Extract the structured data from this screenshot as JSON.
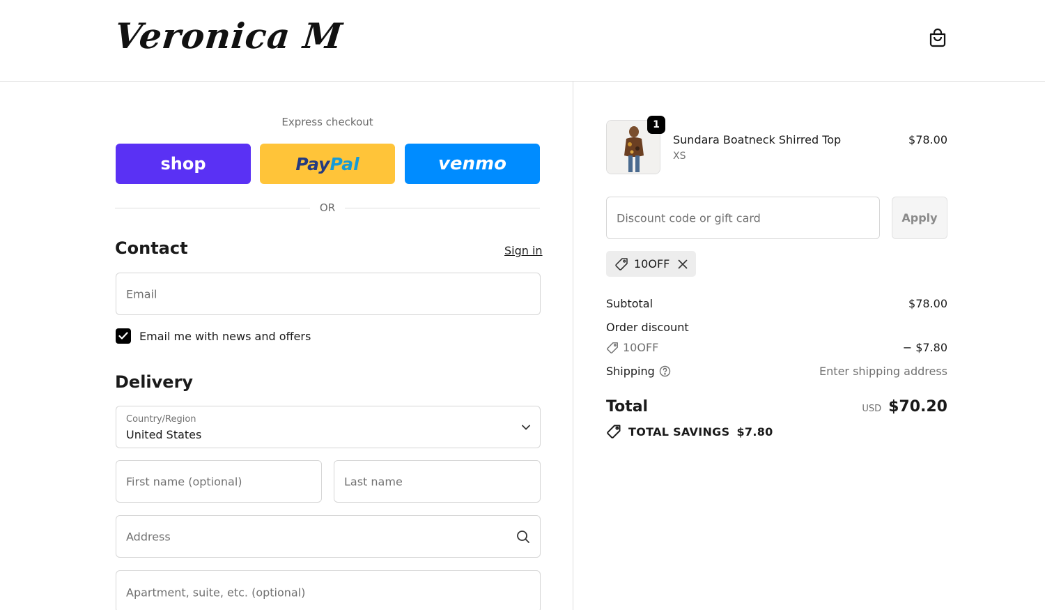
{
  "header": {
    "logo": "Veronica M",
    "cart_icon": "shopping-bag-icon"
  },
  "express": {
    "title": "Express checkout",
    "shop_label": "shop",
    "paypal_part1": "Pay",
    "paypal_part2": "Pal",
    "venmo_label": "venmo",
    "or_label": "OR",
    "colors": {
      "shop": "#5a31f4",
      "paypal": "#ffc439",
      "venmo": "#008cff"
    }
  },
  "contact": {
    "title": "Contact",
    "sign_in": "Sign in",
    "email_placeholder": "Email",
    "newsletter_label": "Email me with news and offers",
    "newsletter_checked": true
  },
  "delivery": {
    "title": "Delivery",
    "country_label": "Country/Region",
    "country_value": "United States",
    "first_name_placeholder": "First name (optional)",
    "last_name_placeholder": "Last name",
    "address_placeholder": "Address",
    "apartment_placeholder": "Apartment, suite, etc. (optional)"
  },
  "summary": {
    "item": {
      "quantity": "1",
      "name": "Sundara Boatneck Shirred Top",
      "variant": "XS",
      "price": "$78.00"
    },
    "discount_placeholder": "Discount code or gift card",
    "apply_label": "Apply",
    "applied_code": "10OFF",
    "subtotal_label": "Subtotal",
    "subtotal_value": "$78.00",
    "order_discount_label": "Order discount",
    "discount_code": "10OFF",
    "discount_value": "− $7.80",
    "shipping_label": "Shipping",
    "shipping_value": "Enter shipping address",
    "total_label": "Total",
    "total_currency": "USD",
    "total_value": "$70.20",
    "savings_label": "TOTAL SAVINGS",
    "savings_value": "$7.80"
  }
}
